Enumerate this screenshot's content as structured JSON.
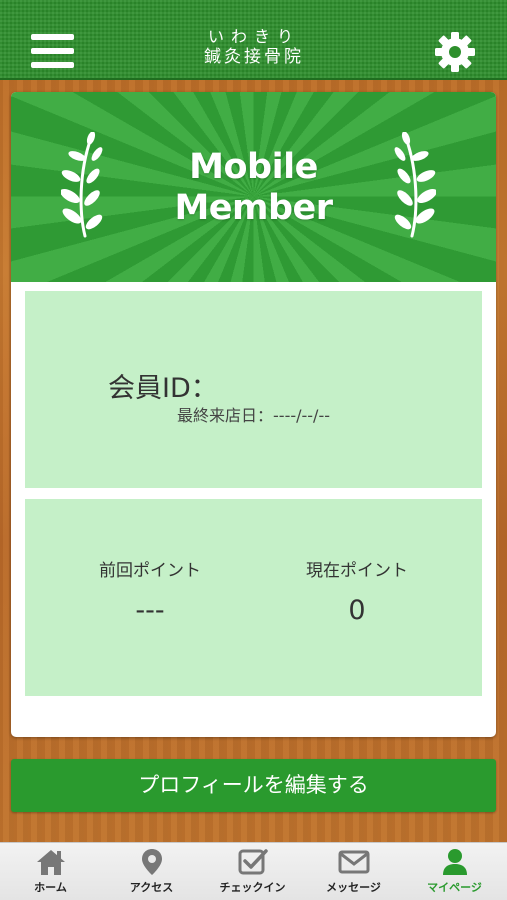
{
  "header": {
    "logo_line1": "いわきり",
    "logo_line2": "鍼灸接骨院"
  },
  "banner": {
    "title_line1": "Mobile",
    "title_line2": "Member"
  },
  "member": {
    "id_label": "会員ID：",
    "last_visit_label": "最終来店日：",
    "last_visit_value": "----/--/--"
  },
  "points": {
    "previous_label": "前回ポイント",
    "previous_value": "---",
    "current_label": "現在ポイント",
    "current_value": "0"
  },
  "edit_profile_label": "プロフィールを編集する",
  "tabs": [
    {
      "label": "ホーム",
      "icon": "home-icon"
    },
    {
      "label": "アクセス",
      "icon": "map-pin-icon"
    },
    {
      "label": "チェックイン",
      "icon": "checkbox-icon"
    },
    {
      "label": "メッセージ",
      "icon": "envelope-icon"
    },
    {
      "label": "マイページ",
      "icon": "user-icon",
      "active": true
    }
  ],
  "colors": {
    "brand_green": "#2d8f2c",
    "panel_green": "#c5f0c8",
    "button_green": "#2a9a2e",
    "wood": "#c67a32"
  }
}
